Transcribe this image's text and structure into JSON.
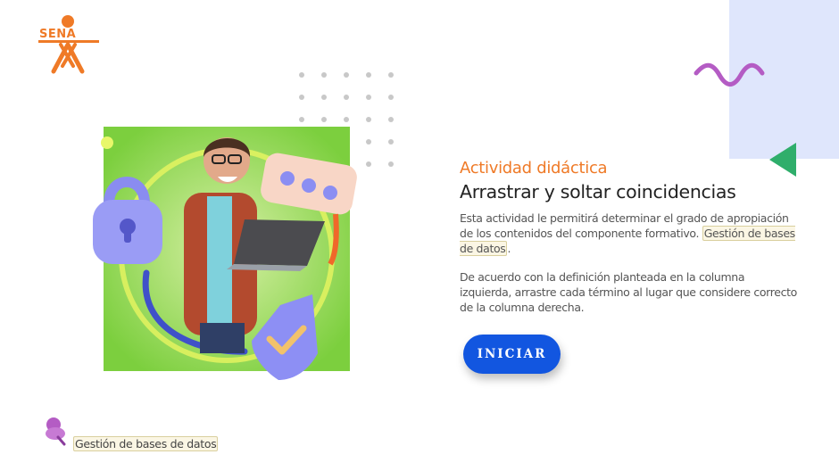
{
  "brand": {
    "logo_text": "SENA",
    "color": "#ef7a27"
  },
  "content": {
    "eyebrow": "Actividad didáctica",
    "title": "Arrastrar y soltar coincidencias",
    "paragraph1_text": "Esta actividad le permitirá determinar el grado de apropiación de los contenidos del componente formativo. ",
    "paragraph1_tag": "Gestión de bases de datos",
    "paragraph1_end": ".",
    "paragraph2": "De acuerdo con la definición planteada en la columna izquierda, arrastre cada término al lugar que considere correcto de la columna derecha."
  },
  "actions": {
    "start_label": "INICIAR"
  },
  "footer": {
    "course_tag": "Gestión de bases de datos"
  },
  "colors": {
    "accent": "#ef7a27",
    "button": "#1256e0",
    "panel": "#dfe6fc",
    "wave": "#b45cc4",
    "triangle": "#2fae6b"
  }
}
